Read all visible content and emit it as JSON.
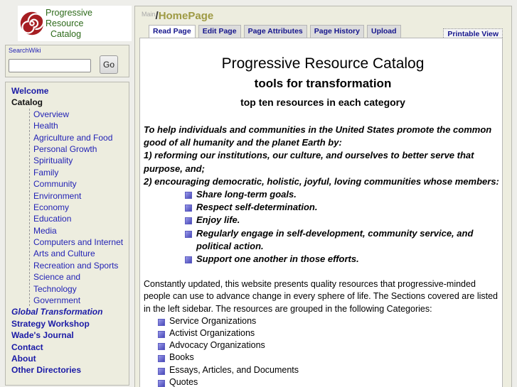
{
  "logo": {
    "line1": "Progressive Resource",
    "line2": "Catalog",
    "spiral_color": "#a61e22",
    "text_color": "#2d6a1a"
  },
  "search": {
    "label": "SearchWiki",
    "value": "",
    "placeholder": "",
    "button_label": "Go"
  },
  "nav": {
    "top_before": [
      {
        "label": "Welcome",
        "current": false,
        "italic": false
      },
      {
        "label": "Catalog",
        "current": true,
        "italic": false
      }
    ],
    "catalog_items": [
      "Overview",
      "Health",
      "Agriculture and Food",
      "Personal Growth",
      "Spirituality",
      "Family",
      "Community",
      "Environment",
      "Economy",
      "Education",
      "Media",
      "Computers and Internet",
      "Arts and Culture",
      "Recreation and Sports",
      "Science and",
      "Technology",
      "Government"
    ],
    "top_after": [
      {
        "label": "Global Transformation",
        "italic": true
      },
      {
        "label": "Strategy Workshop",
        "italic": false
      },
      {
        "label": "Wade's Journal",
        "italic": false
      },
      {
        "label": "Contact",
        "italic": false
      },
      {
        "label": "About",
        "italic": false
      },
      {
        "label": "Other Directories",
        "italic": false
      }
    ]
  },
  "breadcrumb": {
    "group": "Main",
    "separator": "/",
    "page": "HomePage"
  },
  "tabs": [
    {
      "label": "Read Page",
      "active": true
    },
    {
      "label": "Edit Page",
      "active": false
    },
    {
      "label": "Page Attributes",
      "active": false
    },
    {
      "label": "Page History",
      "active": false
    },
    {
      "label": "Upload",
      "active": false
    }
  ],
  "printable_view": "Printable View",
  "content": {
    "title": "Progressive Resource Catalog",
    "subtitle": "tools for transformation",
    "tagline": "top ten resources in each category",
    "mission": [
      "To help individuals and communities in the United States promote the common good of all humanity and the planet Earth by:",
      "1) reforming our institutions, our culture, and ourselves to better serve that purpose, and;",
      "2) encouraging democratic, holistic, joyful, loving communities whose members:"
    ],
    "values": [
      "Share long-term goals.",
      "Respect self-determination.",
      "Enjoy life.",
      "Regularly engage in self-development, community service, and political action.",
      "Support one another in those efforts."
    ],
    "intro": "Constantly updated, this website presents quality resources that progressive-minded people can use to advance change in every sphere of life. The Sections covered are listed in the left sidebar. The resources are grouped in the following Categories:",
    "categories": [
      "Service Organizations",
      "Activist Organizations",
      "Advocacy Organizations",
      "Books",
      "Essays, Articles, and Documents",
      "Quotes"
    ]
  }
}
